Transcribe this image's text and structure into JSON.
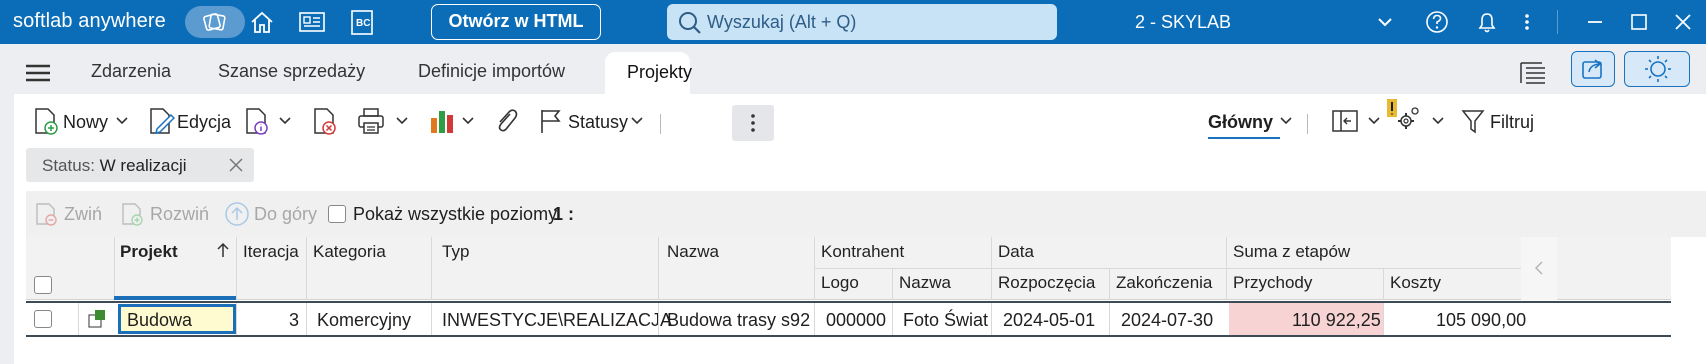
{
  "titlebar": {
    "brand": "softlab anywhere",
    "open_html_label": "Otwórz w HTML",
    "search_placeholder": "Wyszukaj (Alt + Q)",
    "company": "2 - SKYLAB",
    "bc_icon_text": "BC"
  },
  "tabs": [
    {
      "label": "Zdarzenia"
    },
    {
      "label": "Szanse sprzedaży"
    },
    {
      "label": "Definicje importów"
    },
    {
      "label": "Projekty",
      "active": true
    }
  ],
  "toolbar": {
    "new_label": "Nowy",
    "edit_label": "Edycja",
    "statuses_label": "Statusy",
    "view_label": "Główny",
    "filter_label": "Filtruj"
  },
  "status_filter": {
    "prefix": "Status: ",
    "value": "W realizacji"
  },
  "subtoolbar": {
    "collapse_label": "Zwiń",
    "expand_label": "Rozwiń",
    "up_label": "Do góry",
    "show_all_label": "Pokaż wszystkie poziomy",
    "level_label": "1 :"
  },
  "grid": {
    "headers": {
      "project": "Projekt",
      "iteration": "Iteracja",
      "category": "Kategoria",
      "type": "Typ",
      "name": "Nazwa",
      "contractor": "Kontrahent",
      "contractor_logo": "Logo",
      "contractor_name": "Nazwa",
      "date": "Data",
      "date_start": "Rozpoczęcia",
      "date_end": "Zakończenia",
      "sum_stages": "Suma z etapów",
      "revenue": "Przychody",
      "costs": "Koszty"
    },
    "rows": [
      {
        "project": "Budowa",
        "iteration": "3",
        "category": "Komercyjny",
        "type": "INWESTYCJE\\REALIZACJA",
        "name": "Budowa trasy s92",
        "contractor_logo": "000000",
        "contractor_name": "Foto Świat",
        "date_start": "2024-05-01",
        "date_end": "2024-07-30",
        "revenue": "110 922,25",
        "costs": "105 090,00"
      }
    ]
  },
  "colors": {
    "titlebar": "#0b6db8",
    "accent": "#1a73c0",
    "revenue_highlight": "#f7d3d3",
    "edit_cell": "#fffbd0"
  }
}
